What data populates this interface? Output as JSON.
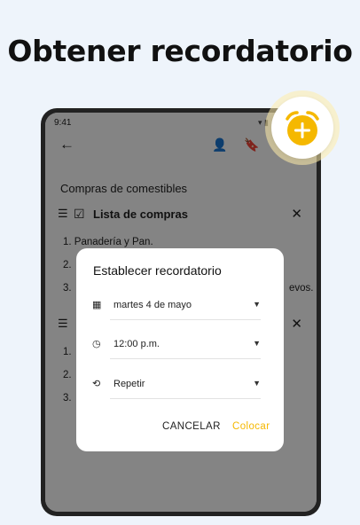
{
  "headline": "Obtener recordatorio",
  "statusbar": {
    "time": "9:41",
    "icons": "▾ ▮"
  },
  "appbar": {
    "back_glyph": "←",
    "listen_glyph": "👤",
    "bookmark_glyph": "🔖"
  },
  "note": {
    "title": "Compras de comestibles",
    "lists": [
      {
        "title": "Lista de compras",
        "items": [
          "1. Panadería y Pan.",
          "2.",
          "3."
        ],
        "trailing_text": "evos."
      },
      {
        "title": "",
        "items": [
          "1.",
          "2.",
          "3."
        ]
      }
    ],
    "drag_glyph": "☰",
    "check_glyph": "☑",
    "close_glyph": "✕"
  },
  "dialog": {
    "title": "Establecer recordatorio",
    "fields": [
      {
        "icon": "calendar-icon",
        "glyph": "▦",
        "value": "martes 4 de mayo"
      },
      {
        "icon": "clock-icon",
        "glyph": "◷",
        "value": "12:00 p.m."
      },
      {
        "icon": "repeat-icon",
        "glyph": "⟲",
        "value": "Repetir"
      }
    ],
    "dropdown_glyph": "▼",
    "cancel_label": "CANCELAR",
    "ok_label": "Colocar"
  },
  "colors": {
    "accent": "#f5b800",
    "background": "#eef4fb",
    "scrim": "rgba(0,0,0,0.48)"
  }
}
